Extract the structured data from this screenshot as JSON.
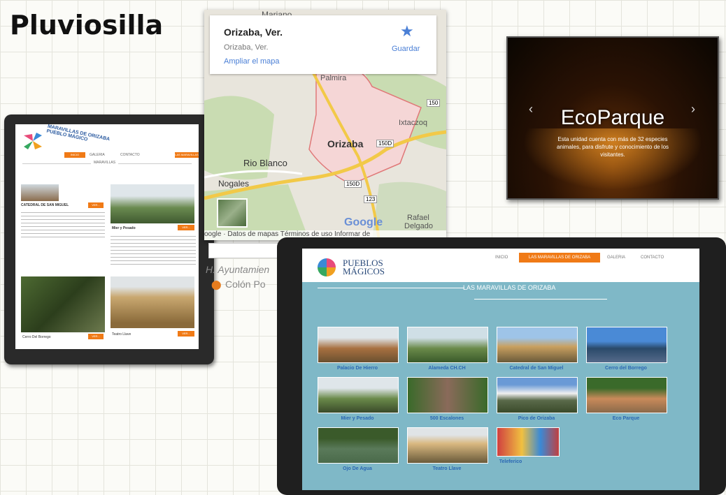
{
  "title": "Pluviosilla",
  "left_site": {
    "logo_text": "MARAVILLAS DE ORIZABA PUEBLO MÁGICO",
    "nav": [
      "INICIO",
      "GALERIA",
      "CONTACTO",
      "LAS MARAVILLAS"
    ],
    "section": "MARAVILLAS",
    "cards": [
      {
        "title": "CATEDRAL DE SAN MIGUEL",
        "button": "VER..."
      },
      {
        "title": "Mier y Pesado",
        "button": "VER..."
      },
      {
        "title": "Cerro Del Borrego",
        "button": "VER..."
      },
      {
        "title": "Teatro Llave",
        "button": "VER..."
      }
    ]
  },
  "map": {
    "place_title": "Orizaba, Ver.",
    "place_sub": "Orizaba, Ver.",
    "enlarge": "Ampliar el mapa",
    "save": "Guardar",
    "labels": {
      "mariano": "Mariano",
      "palmira": "Palmira",
      "orizaba": "Orizaba",
      "rio_blanco": "Rio Blanco",
      "nogales": "Nogales",
      "ixtaczoquitlan": "Ixtaczoq",
      "rafael": "Rafael",
      "delgado": "Delgado",
      "google": "Google"
    },
    "roads": [
      "150D",
      "150",
      "150D",
      "123"
    ],
    "footer": "oogle · Datos de mapas   Términos de uso   Informar de",
    "list": [
      "H. Ayuntamien",
      "Colón Po"
    ]
  },
  "eco": {
    "heading": "EcoParque",
    "text": "Esta unidad cuenta con más de 32 especies animales, para disfrute y conocimiento de los visitantes."
  },
  "right_site": {
    "logo": [
      "PUEBLOS",
      "MÁGICOS"
    ],
    "nav": [
      "INICIO",
      "LAS MARAVILLAS DE ORIZABA",
      "GALERIA",
      "CONTACTO"
    ],
    "heading": "LAS MARAVILLAS DE ORIZABA",
    "gallery": [
      "Palacio De Hierro",
      "Alameda CH.CH",
      "Catedral de San Miguel",
      "Cerro del Borrego",
      "Mier y Pesado",
      "500 Escalones",
      "Pico de Orizaba",
      "Eco Parque",
      "Ojo De Agua",
      "Teatro Llave",
      "Teleferico"
    ]
  },
  "colors": {
    "accent": "#f07a16",
    "link": "#2a67b3",
    "site_bg": "#7fb8c7"
  }
}
